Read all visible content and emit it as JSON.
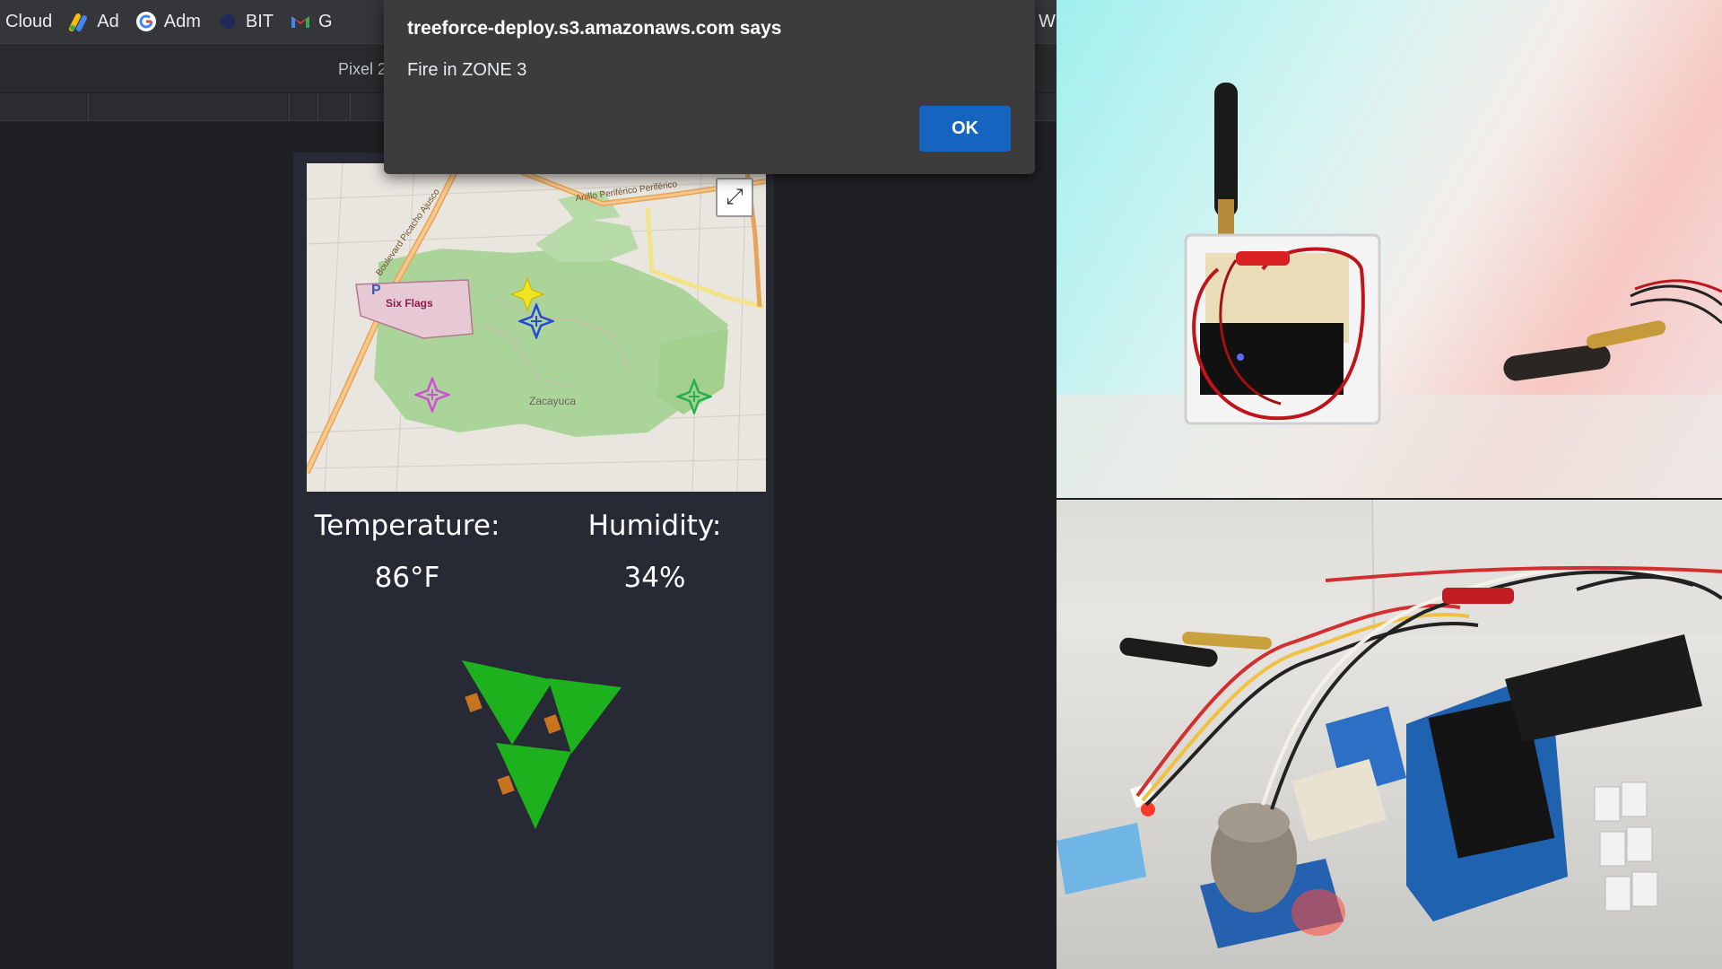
{
  "bookmarks": [
    {
      "label": "Cloud",
      "icon": "cloud-icon"
    },
    {
      "label": "Ad",
      "icon": "google-ads-icon"
    },
    {
      "label": "Adm",
      "icon": "google-icon"
    },
    {
      "label": "BIT",
      "icon": "bitbucket-icon"
    },
    {
      "label": "G",
      "icon": "gmail-icon"
    },
    {
      "label": "W",
      "icon": "bookmark-icon"
    }
  ],
  "devtools": {
    "device_label": "Pixel 2"
  },
  "dialog": {
    "title": "treeforce-deploy.s3.amazonaws.com says",
    "message": "Fire in ZONE 3",
    "ok_label": "OK"
  },
  "map": {
    "labels": {
      "road": "Boulevard Picacho Ajusco",
      "periferico": "Anillo Periférico Periférico",
      "park": "Six Flags",
      "parking": "P",
      "zone": "Zacayuca"
    },
    "markers": [
      {
        "zone": "yellow",
        "color": "#f0e321"
      },
      {
        "zone": "blue",
        "color": "#2947d6"
      },
      {
        "zone": "magenta",
        "color": "#d24bd6"
      },
      {
        "zone": "green",
        "color": "#22b14c"
      }
    ]
  },
  "sensors": {
    "temperature_label": "Temperature:",
    "temperature_value": "86°F",
    "humidity_label": "Humidity:",
    "humidity_value": "34%"
  },
  "colors": {
    "accent": "#1565c0",
    "logo_green": "#1db21d",
    "logo_orange": "#c8741e",
    "page_bg": "#272a35"
  }
}
